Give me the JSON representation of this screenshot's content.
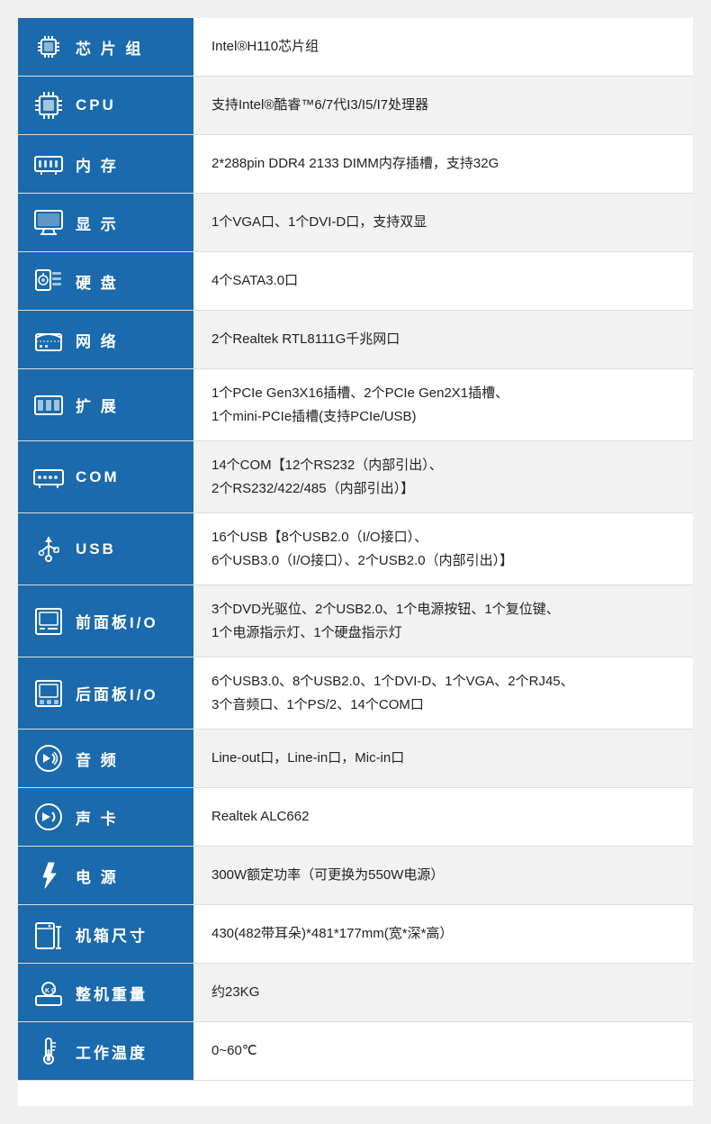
{
  "rows": [
    {
      "id": "chipset",
      "icon": "chipset",
      "label": "芯 片 组",
      "value": "Intel®H110芯片组"
    },
    {
      "id": "cpu",
      "icon": "cpu",
      "label": "CPU",
      "value": "支持Intel®酷睿™6/7代I3/I5/I7处理器"
    },
    {
      "id": "memory",
      "icon": "memory",
      "label": "内 存",
      "value": "2*288pin DDR4 2133 DIMM内存插槽，支持32G"
    },
    {
      "id": "display",
      "icon": "display",
      "label": "显 示",
      "value": "1个VGA口、1个DVI-D口，支持双显"
    },
    {
      "id": "hdd",
      "icon": "hdd",
      "label": "硬 盘",
      "value": "4个SATA3.0口"
    },
    {
      "id": "network",
      "icon": "network",
      "label": "网 络",
      "value": "2个Realtek RTL8111G千兆网口"
    },
    {
      "id": "expand",
      "icon": "expand",
      "label": "扩 展",
      "value": "1个PCIe Gen3X16插槽、2个PCIe Gen2X1插槽、\n1个mini-PCIe插槽(支持PCIe/USB)"
    },
    {
      "id": "com",
      "icon": "com",
      "label": "COM",
      "value": "14个COM【12个RS232（内部引出）、\n2个RS232/422/485（内部引出）】"
    },
    {
      "id": "usb",
      "icon": "usb",
      "label": "USB",
      "value": "16个USB【8个USB2.0（I/O接口）、\n6个USB3.0（I/O接口）、2个USB2.0（内部引出）】"
    },
    {
      "id": "front-io",
      "icon": "frontio",
      "label": "前面板I/O",
      "value": "3个DVD光驱位、2个USB2.0、1个电源按钮、1个复位键、\n1个电源指示灯、1个硬盘指示灯"
    },
    {
      "id": "rear-io",
      "icon": "reario",
      "label": "后面板I/O",
      "value": "6个USB3.0、8个USB2.0、1个DVI-D、1个VGA、2个RJ45、\n3个音频口、1个PS/2、14个COM口"
    },
    {
      "id": "audio",
      "icon": "audio",
      "label": "音 频",
      "value": "Line-out口，Line-in口，Mic-in口"
    },
    {
      "id": "soundcard",
      "icon": "soundcard",
      "label": "声 卡",
      "value": "Realtek ALC662"
    },
    {
      "id": "power",
      "icon": "power",
      "label": "电 源",
      "value": "300W额定功率（可更换为550W电源）"
    },
    {
      "id": "case-size",
      "icon": "casesize",
      "label": "机箱尺寸",
      "value": "430(482带耳朵)*481*177mm(宽*深*高）"
    },
    {
      "id": "weight",
      "icon": "weight",
      "label": "整机重量",
      "value": "约23KG"
    },
    {
      "id": "temp",
      "icon": "temp",
      "label": "工作温度",
      "value": "0~60℃"
    }
  ]
}
